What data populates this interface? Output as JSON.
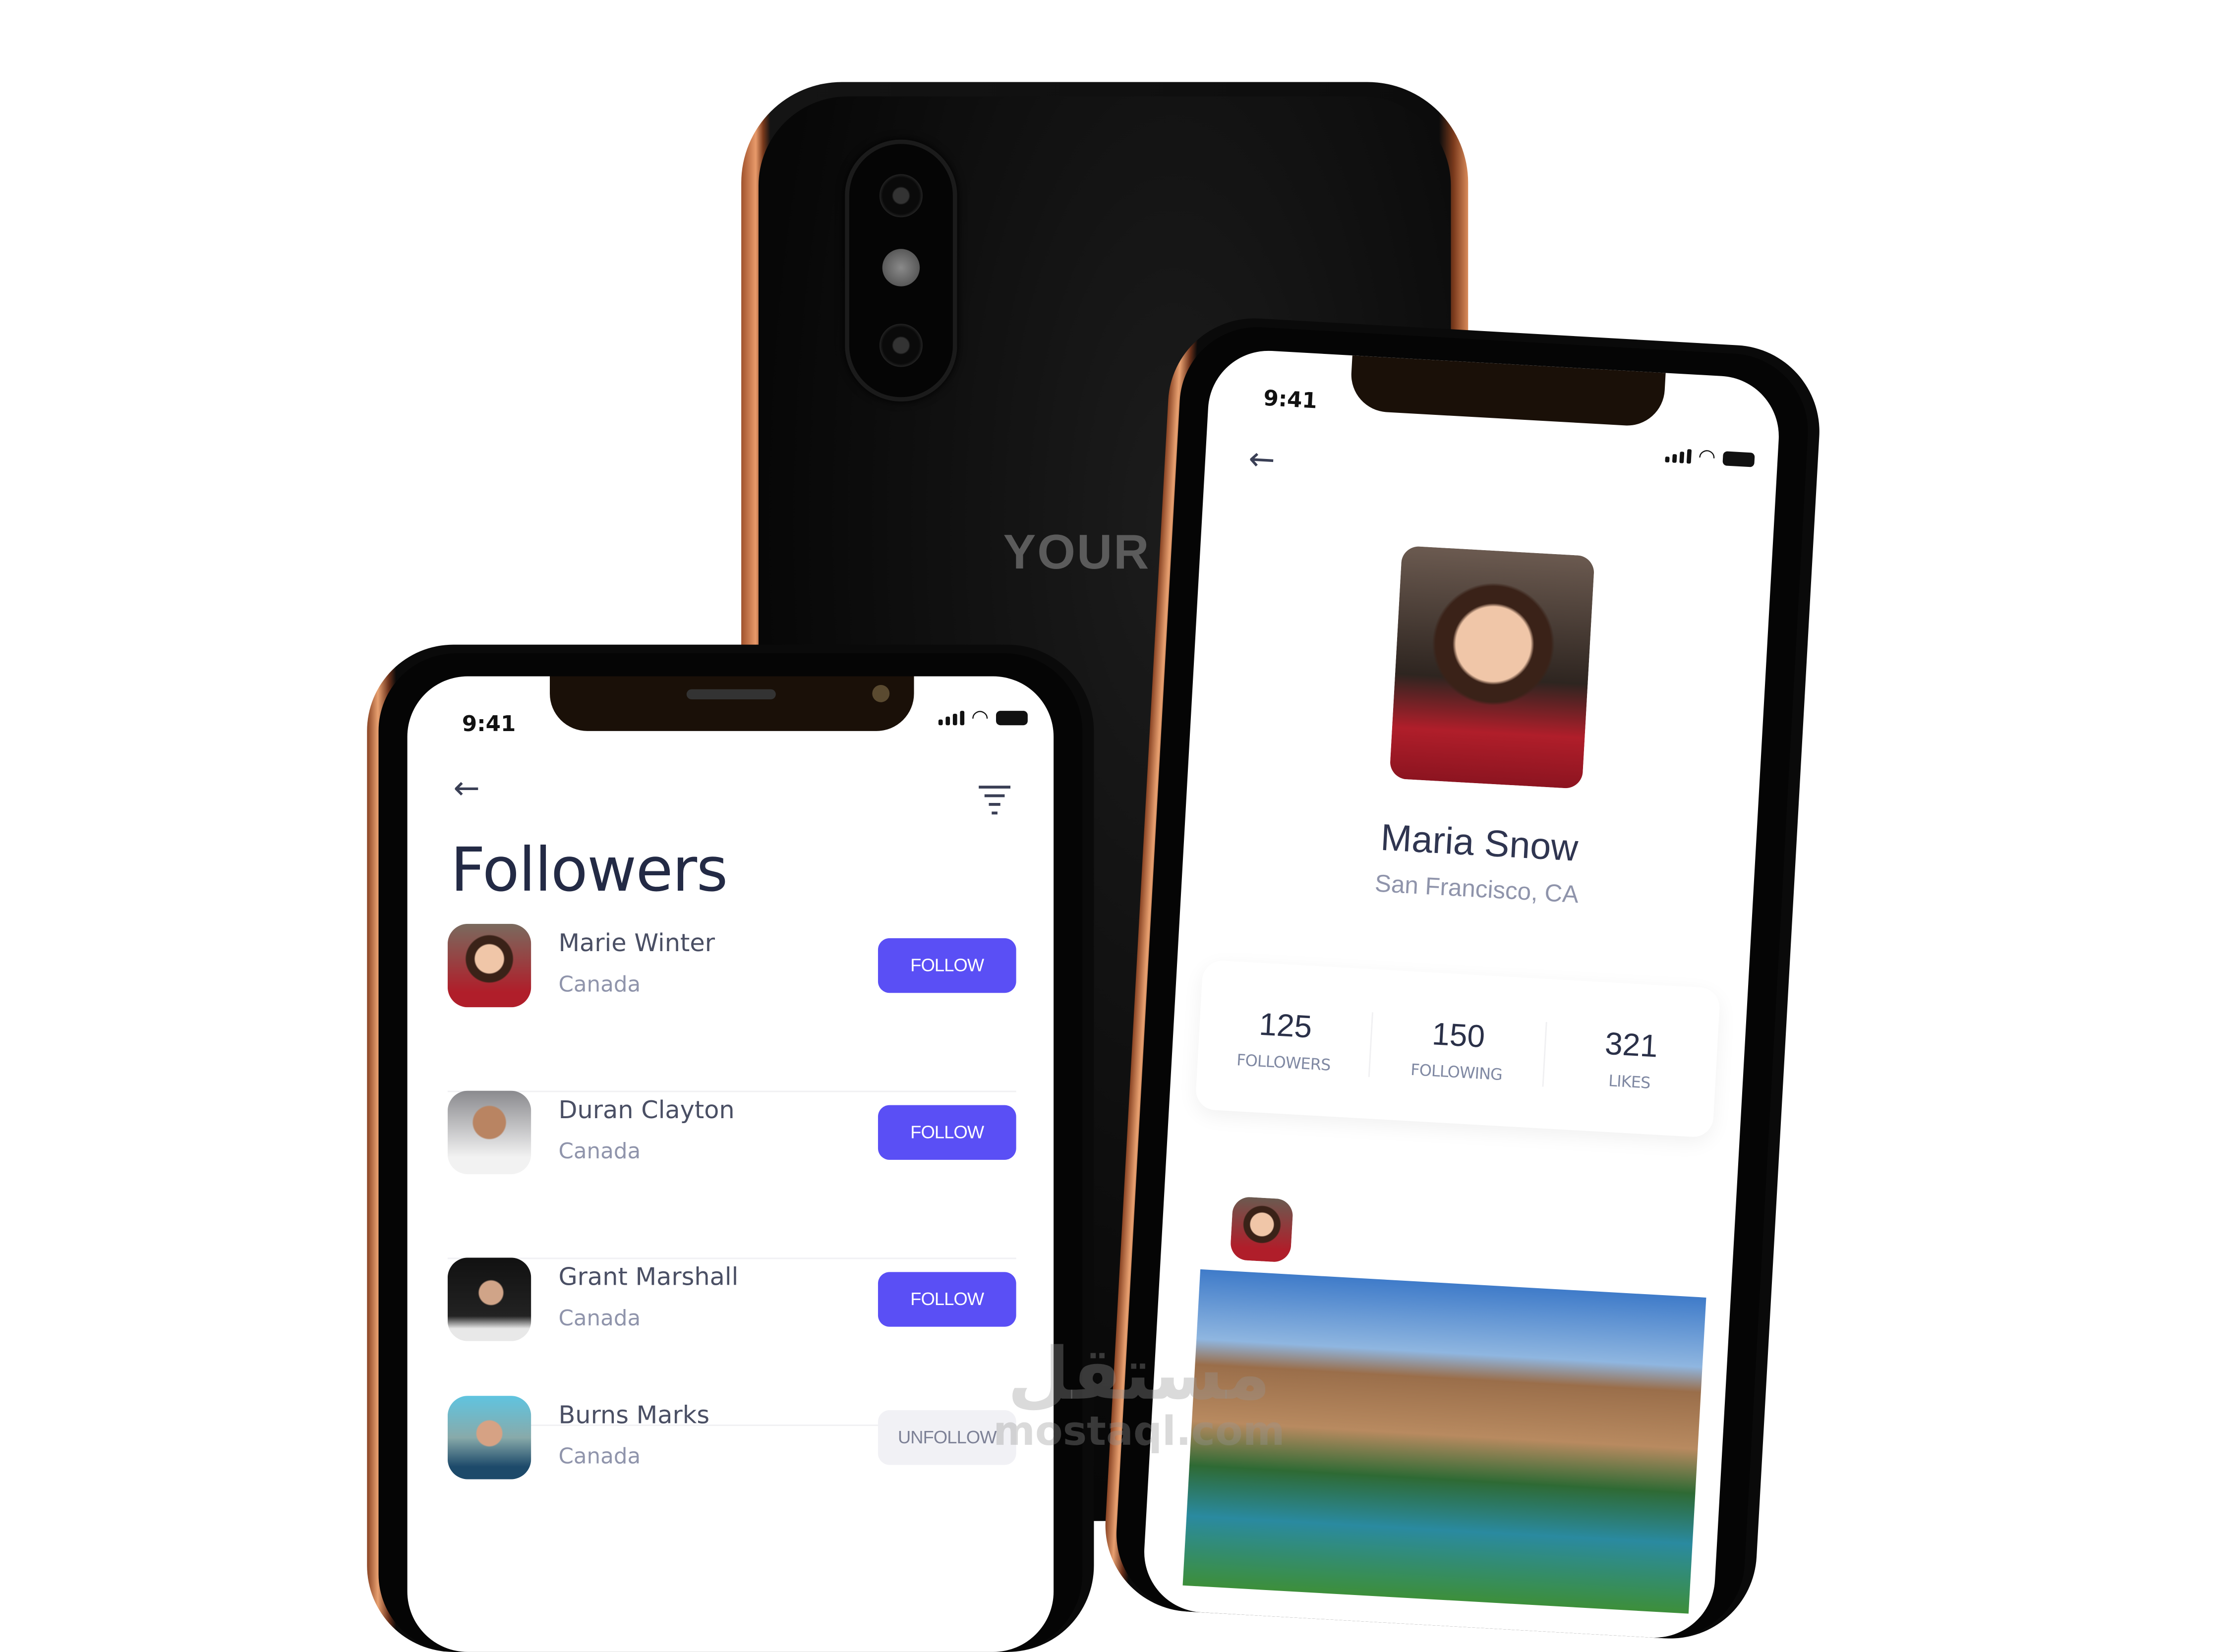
{
  "back_phone": {
    "brand_text": "YOUR L"
  },
  "followers_screen": {
    "status_time": "9:41",
    "title": "Followers",
    "icons": {
      "back": "arrow-left-icon",
      "filter": "filter-icon"
    },
    "followers": [
      {
        "name": "Marie Winter",
        "country": "Canada",
        "action": "FOLLOW"
      },
      {
        "name": "Duran Clayton",
        "country": "Canada",
        "action": "FOLLOW"
      },
      {
        "name": "Grant Marshall",
        "country": "Canada",
        "action": "FOLLOW"
      },
      {
        "name": "Burns Marks",
        "country": "Canada",
        "action": "UNFOLLOW"
      }
    ]
  },
  "profile_screen": {
    "status_time": "9:41",
    "name": "Maria Snow",
    "location": "San Francisco, CA",
    "stats": [
      {
        "value": "125",
        "label": "FOLLOWERS"
      },
      {
        "value": "150",
        "label": "FOLLOWING"
      },
      {
        "value": "321",
        "label": "LIKES"
      }
    ]
  },
  "colors": {
    "accent": "#5a4ff5",
    "text_dark": "#232a45",
    "text_muted": "#8f94ab",
    "frame": "#c87a4c"
  },
  "watermark": {
    "arabic": "مستقل",
    "latin": "mostaql.com"
  }
}
